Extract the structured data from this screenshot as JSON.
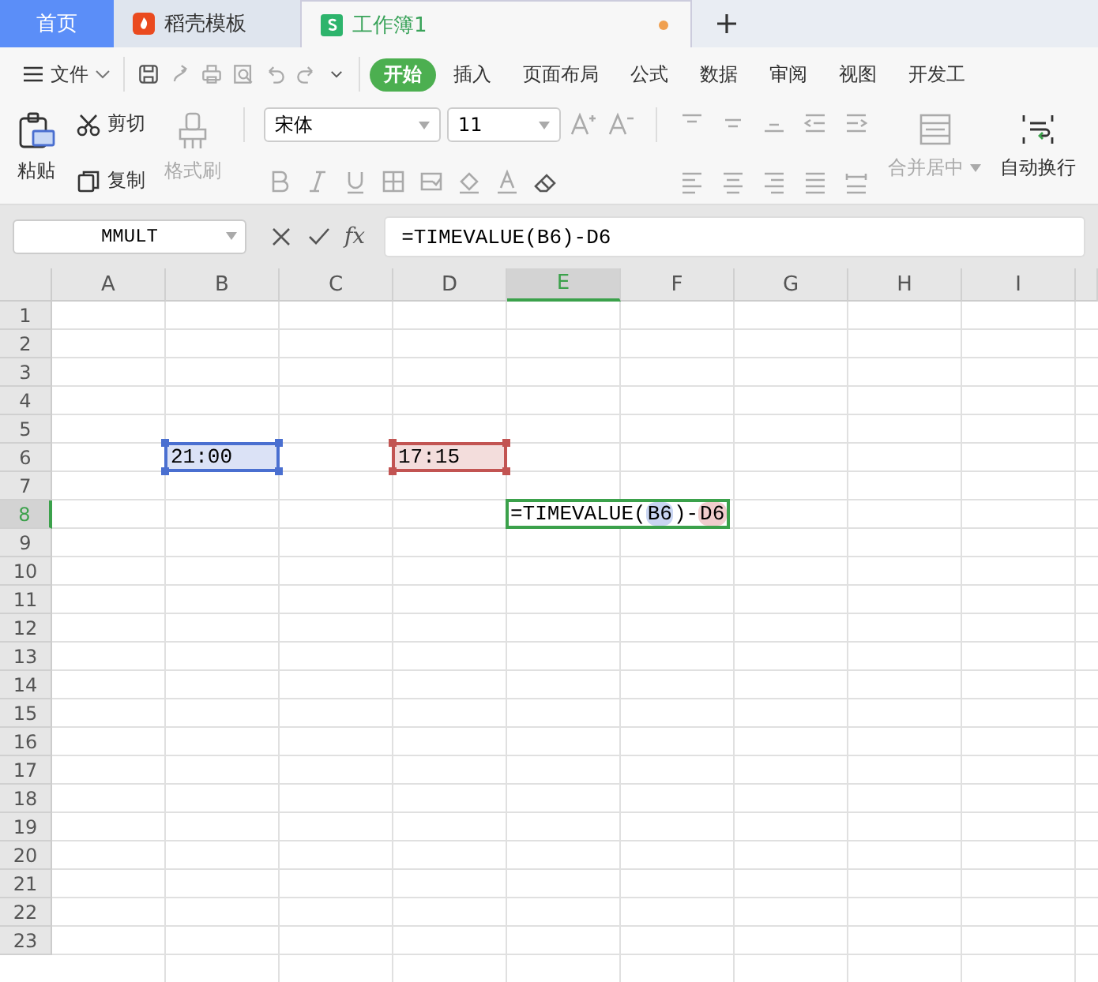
{
  "tabs": [
    {
      "label": "首页",
      "kind": "home",
      "selected": false
    },
    {
      "label": "稻壳模板",
      "kind": "docer",
      "selected": false
    },
    {
      "label": "工作簿1",
      "kind": "sheet",
      "selected": true,
      "unsaved": true
    }
  ],
  "menu": {
    "file": "文件",
    "items": [
      {
        "label": "开始",
        "selected": true
      },
      {
        "label": "插入",
        "selected": false
      },
      {
        "label": "页面布局",
        "selected": false
      },
      {
        "label": "公式",
        "selected": false
      },
      {
        "label": "数据",
        "selected": false
      },
      {
        "label": "审阅",
        "selected": false
      },
      {
        "label": "视图",
        "selected": false
      },
      {
        "label": "开发工",
        "selected": false
      }
    ]
  },
  "ribbon": {
    "paste": "粘贴",
    "cut": "剪切",
    "copy": "复制",
    "format_painter": {
      "label": "格式刷",
      "disabled": true
    },
    "font": "宋体",
    "size": "11",
    "merge": {
      "label": "合并居中",
      "disabled": true
    },
    "wrap": {
      "label": "自动换行",
      "disabled": false
    }
  },
  "name_box": "MMULT",
  "fx": "fx",
  "formula": "=TIMEVALUE(B6)-D6",
  "columns": [
    {
      "label": "A",
      "selected": false
    },
    {
      "label": "B",
      "selected": false
    },
    {
      "label": "C",
      "selected": false
    },
    {
      "label": "D",
      "selected": false
    },
    {
      "label": "E",
      "selected": true
    },
    {
      "label": "F",
      "selected": false
    },
    {
      "label": "G",
      "selected": false
    },
    {
      "label": "H",
      "selected": false
    },
    {
      "label": "I",
      "selected": false
    }
  ],
  "rows": [
    {
      "label": "1",
      "selected": false
    },
    {
      "label": "2",
      "selected": false
    },
    {
      "label": "3",
      "selected": false
    },
    {
      "label": "4",
      "selected": false
    },
    {
      "label": "5",
      "selected": false
    },
    {
      "label": "6",
      "selected": false,
      "cells": [
        null,
        {
          "kind": "reference",
          "value": "21:00",
          "color": "#4a6fd0"
        },
        null,
        {
          "kind": "reference",
          "value": "17:15",
          "color": "#c25452"
        }
      ]
    },
    {
      "label": "7",
      "selected": false
    },
    {
      "label": "8",
      "selected": true,
      "cells": [
        null,
        null,
        null,
        null,
        {
          "kind": "editor",
          "parts": [
            {
              "text": "=TIMEVALUE("
            },
            {
              "text": "B6",
              "color": "#c9d5f2"
            },
            {
              "text": ")-"
            },
            {
              "text": "D6",
              "color": "#f0cdcd"
            }
          ]
        }
      ]
    },
    {
      "label": "9",
      "selected": false
    },
    {
      "label": "10",
      "selected": false
    },
    {
      "label": "11",
      "selected": false
    },
    {
      "label": "12",
      "selected": false
    },
    {
      "label": "13",
      "selected": false
    },
    {
      "label": "14",
      "selected": false
    },
    {
      "label": "15",
      "selected": false
    },
    {
      "label": "16",
      "selected": false
    },
    {
      "label": "17",
      "selected": false
    },
    {
      "label": "18",
      "selected": false
    },
    {
      "label": "19",
      "selected": false
    },
    {
      "label": "20",
      "selected": false
    },
    {
      "label": "21",
      "selected": false
    },
    {
      "label": "22",
      "selected": false
    },
    {
      "label": "23",
      "selected": false
    }
  ]
}
